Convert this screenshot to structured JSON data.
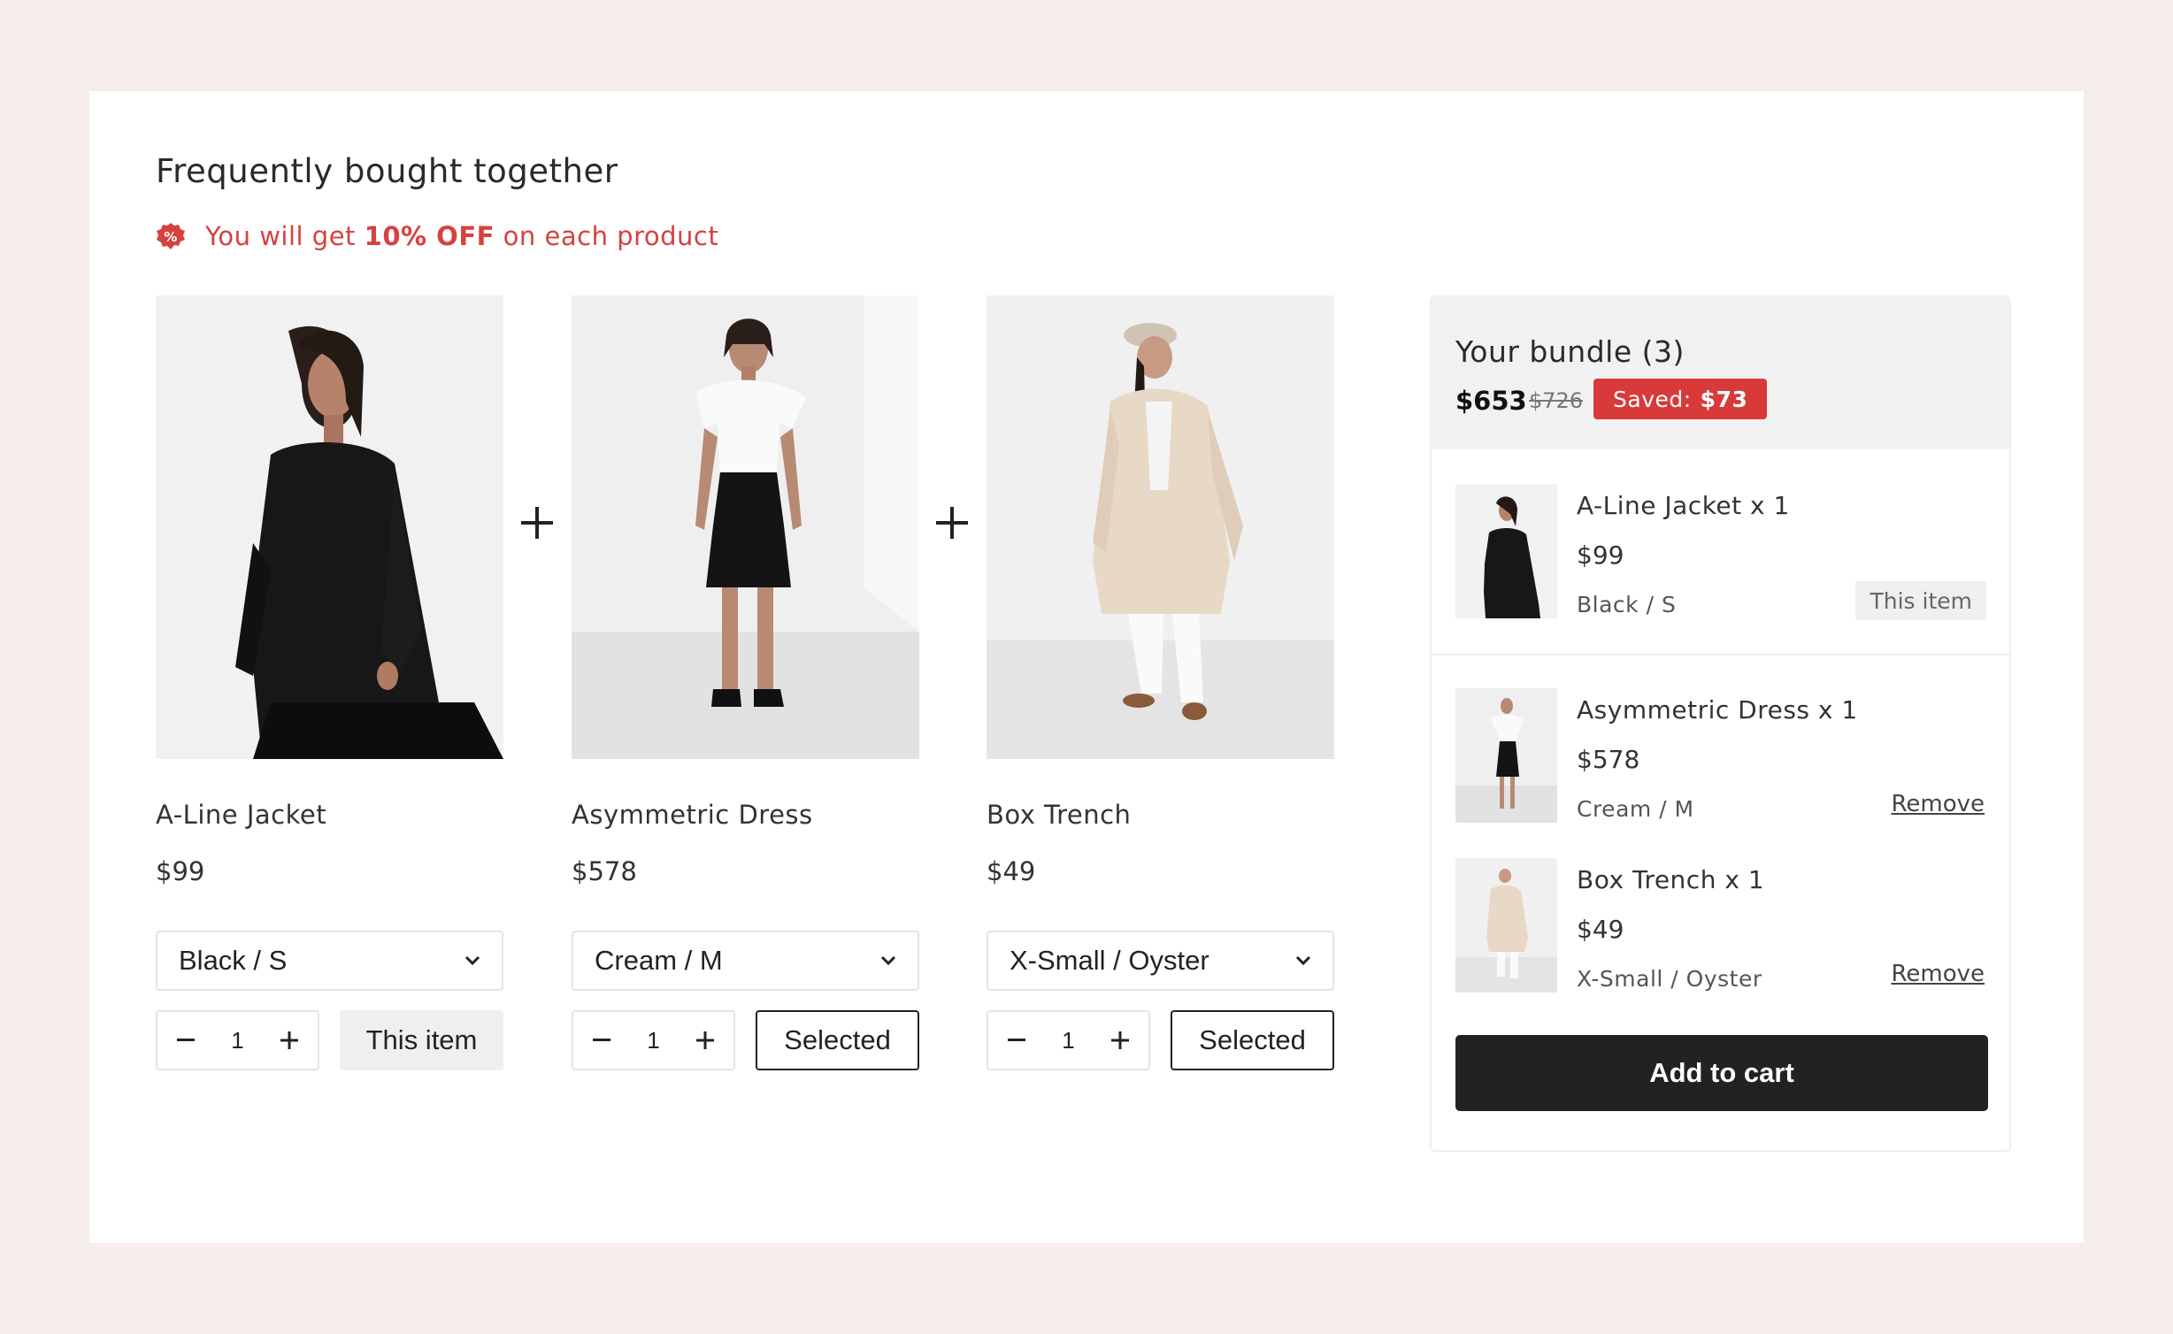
{
  "section": {
    "heading": "Frequently bought together",
    "promo": {
      "prefix": "You will get ",
      "highlight": "10% OFF",
      "suffix": " on each product"
    }
  },
  "products": [
    {
      "name": "A-Line Jacket",
      "price": "$99",
      "variant": "Black / S",
      "qty": "1",
      "action": "This item"
    },
    {
      "name": "Asymmetric Dress",
      "price": "$578",
      "variant": "Cream / M",
      "qty": "1",
      "action": "Selected"
    },
    {
      "name": "Box Trench",
      "price": "$49",
      "variant": "X-Small / Oyster",
      "qty": "1",
      "action": "Selected"
    }
  ],
  "bundle": {
    "title": "Your bundle (3)",
    "total": "$653",
    "original": "$726",
    "saved_label": "Saved:",
    "saved_amount": "$73",
    "items": [
      {
        "name": "A-Line Jacket x 1",
        "price": "$99",
        "variant": "Black / S",
        "tag": "This item"
      },
      {
        "name": "Asymmetric Dress x 1",
        "price": "$578",
        "variant": "Cream / M",
        "remove": "Remove"
      },
      {
        "name": "Box Trench x 1",
        "price": "$49",
        "variant": "X-Small / Oyster",
        "remove": "Remove"
      }
    ],
    "cta": "Add to cart"
  },
  "icons": {
    "promo": "discount-badge-icon",
    "plus": "plus-icon",
    "chevron": "chevron-down-icon",
    "minus": "minus-icon"
  },
  "colors": {
    "accent": "#d83a3a",
    "promo_text": "#d6413f",
    "cta_bg": "#222222",
    "page_bg": "#f5eeea"
  }
}
